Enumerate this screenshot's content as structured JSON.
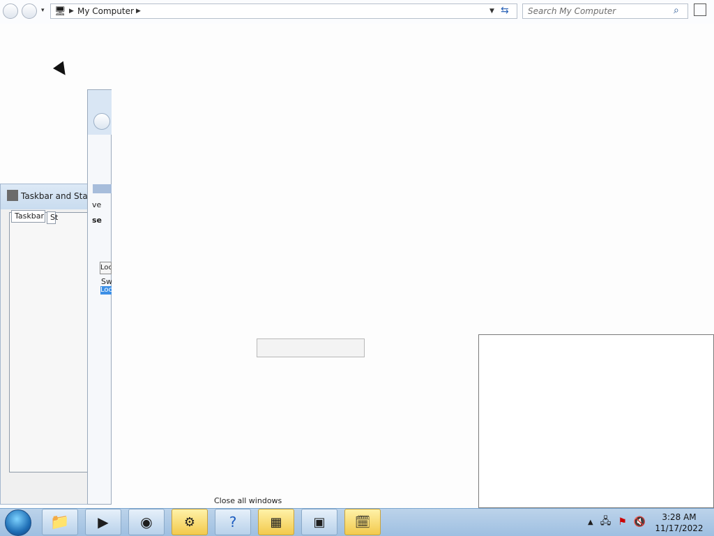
{
  "explorer": {
    "address_root": "My Computer",
    "search_placeholder": "Search My Computer"
  },
  "dialog": {
    "title": "Taskbar and Start",
    "tabs": [
      "Taskbar",
      "St"
    ]
  },
  "background_window": {
    "snippets": [
      "ve",
      "se",
      "Loc",
      "Sw",
      "Loc"
    ]
  },
  "taskbar": {
    "pinned": [
      {
        "name": "explorer-task-button",
        "icon": "folder-icon"
      },
      {
        "name": "media-task-button",
        "icon": "media-player-icon"
      },
      {
        "name": "chrome-task-button",
        "icon": "chrome-icon"
      },
      {
        "name": "control-task-button",
        "icon": "control-panel-icon"
      },
      {
        "name": "help-task-button",
        "icon": "help-icon"
      },
      {
        "name": "calculator-task-button",
        "icon": "calculator-icon"
      },
      {
        "name": "computer-task-button",
        "icon": "computer-icon"
      },
      {
        "name": "scheduler-task-button",
        "icon": "calendar-clock-icon"
      }
    ],
    "hidden_label": "Close all windows",
    "clock_time": "3:28 AM",
    "clock_date": "11/17/2022"
  }
}
